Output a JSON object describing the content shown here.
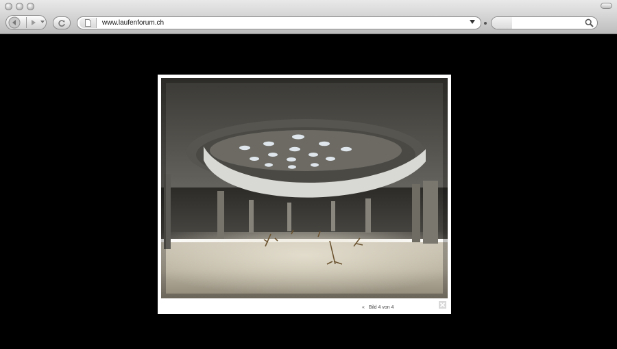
{
  "browser": {
    "url": "www.laufenforum.ch",
    "search_placeholder": ""
  },
  "lightbox": {
    "prev_label": "«",
    "counter": "Bild 4 von 4"
  },
  "photo": {
    "description_icon": "photo-underground-hall"
  },
  "colors": {
    "page_background": "#000000",
    "chrome_light": "#e9e9e9",
    "chrome_dark": "#bdbdbd",
    "frame": "#ffffff"
  }
}
